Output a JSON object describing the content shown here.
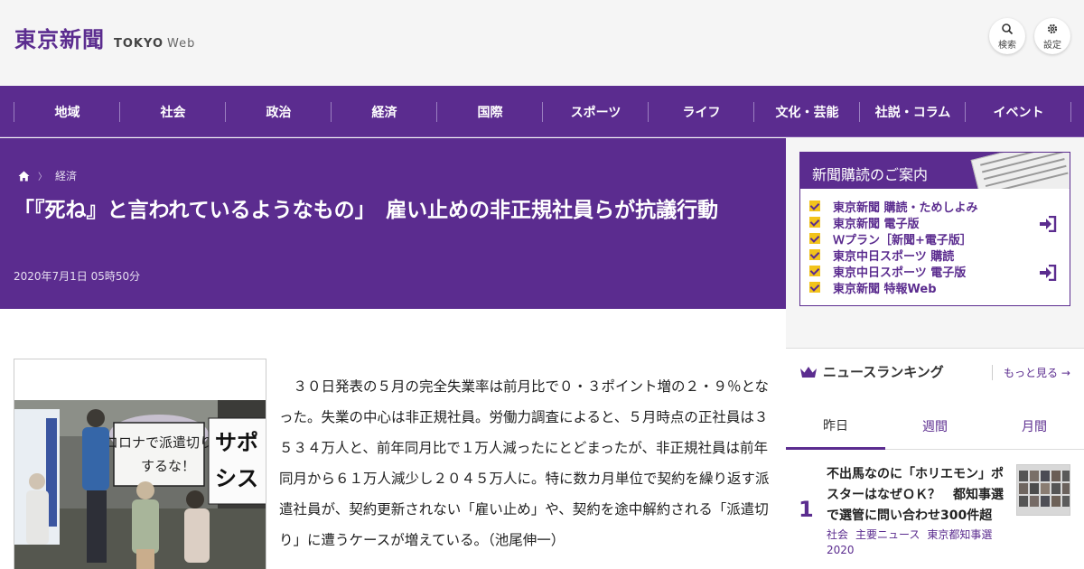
{
  "header": {
    "logo_jp": "東京新聞",
    "logo_en": "TOKYO",
    "logo_web": "Web",
    "search_label": "検索",
    "settings_label": "設定"
  },
  "nav": {
    "items": [
      "地域",
      "社会",
      "政治",
      "経済",
      "国際",
      "スポーツ",
      "ライフ",
      "文化・芸能",
      "社説・コラム",
      "イベント"
    ]
  },
  "breadcrumb": {
    "home_icon": "home-icon",
    "section": "経済"
  },
  "article": {
    "title": "「『死ね』と言われているようなもの」　雇い止めの非正規社員らが抗議行動",
    "date": "2020年7月1日 05時50分",
    "body": "３０日発表の５月の完全失業率は前月比で０・３ポイント増の２・９％となった。失業の中心は非正規社員。労働力調査によると、５月時点の正社員は３５３４万人と、前年同月比で１万人減ったにとどまったが、非正規社員は前年同月から６１万人減少し２０４５万人に。特に数カ月単位で契約を繰り返す派遣社員が、契約更新されない「雇い止め」や、契約を途中解約される「派遣切り」に遭うケースが増えている。（池尾伸一）",
    "photo_sign_text": "コロナで派遣切りするな！",
    "photo_banner_text": "サポ シス"
  },
  "subscription": {
    "heading": "新聞購読のご案内",
    "items": [
      "東京新聞 購読・ためしよみ",
      "東京新聞 電子版",
      "Ｗプラン［新聞+電子版］",
      "東京中日スポーツ 購読",
      "東京中日スポーツ 電子版",
      "東京新聞 特報Web"
    ]
  },
  "ranking": {
    "heading": "ニュースランキング",
    "more": "もっと見る",
    "tabs": [
      "昨日",
      "週間",
      "月間"
    ],
    "active_tab": "昨日",
    "first": {
      "rank": "1",
      "title": "不出馬なのに「ホリエモン」ポスターはなぜＯＫ？　都知事選で選管に問い合わせ300件超",
      "tags": [
        "社会",
        "主要ニュース",
        "東京都知事選2020"
      ]
    }
  },
  "colors": {
    "brand_purple": "#5b2c8f",
    "check_yellow": "#f2c31b"
  }
}
